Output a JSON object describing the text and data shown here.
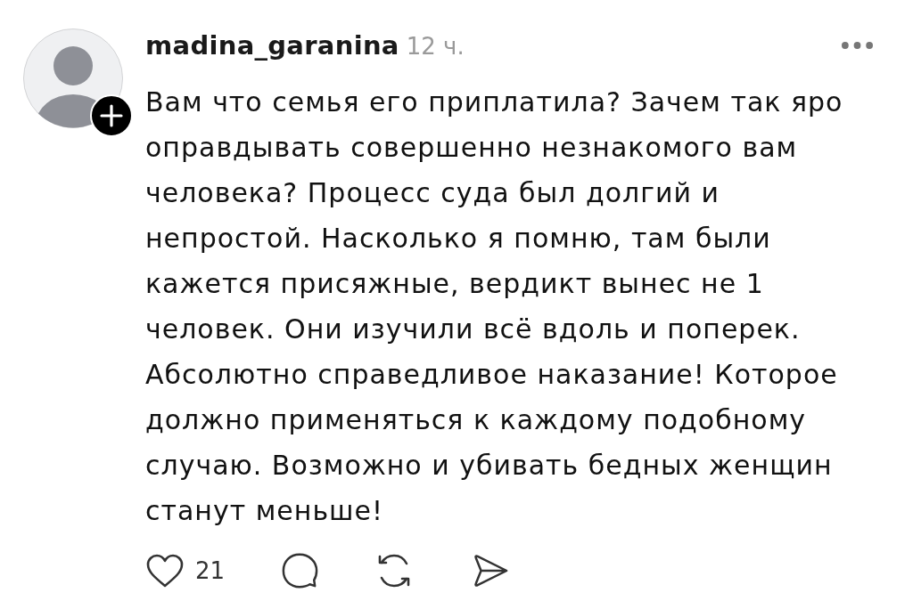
{
  "comment": {
    "username": "madina_garanina",
    "time": "12 ч.",
    "text": "Вам что семья его приплатила? Зачем так яро оправдывать совершенно незнакомого вам человека? Процесс суда был долгий и непростой. Насколько я помню, там были кажется присяжные, вердикт вынес не 1 человек. Они изучили всё вдоль и поперек. Абсолютно справедливое наказание! Которое должно применяться к каждому подобному случаю. Возможно и убивать бедных женщин станут меньше!",
    "liked": false,
    "like_count": "21"
  }
}
